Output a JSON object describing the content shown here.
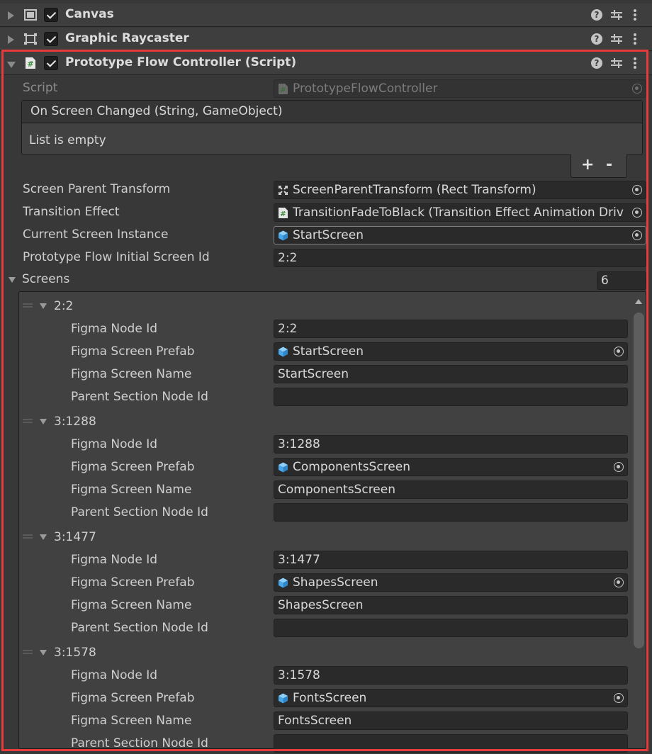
{
  "components": [
    {
      "title": "Canvas",
      "icon": "canvas-icon"
    },
    {
      "title": "Graphic Raycaster",
      "icon": "graphic-raycaster-icon"
    },
    {
      "title": "Prototype Flow Controller (Script)",
      "icon": "script-icon"
    }
  ],
  "script_field": {
    "label": "Script",
    "value": "PrototypeFlowController"
  },
  "event": {
    "title": "On Screen Changed (String, GameObject)",
    "empty_text": "List is empty",
    "add": "+",
    "remove": "-"
  },
  "props": [
    {
      "label": "Screen Parent Transform",
      "value": "ScreenParentTransform (Rect Transform)",
      "icon": "rect-transform-icon"
    },
    {
      "label": "Transition Effect",
      "value": "TransitionFadeToBlack (Transition Effect Animation Driv",
      "icon": "script-icon"
    },
    {
      "label": "Current Screen Instance",
      "value": "StartScreen",
      "icon": "prefab-cube-icon"
    },
    {
      "label": "Prototype Flow Initial Screen Id",
      "value": "2:2"
    }
  ],
  "screens": {
    "label": "Screens",
    "count": "6",
    "items": [
      {
        "id": "2:2",
        "node_id": "2:2",
        "prefab": "StartScreen",
        "name": "StartScreen",
        "parent_section": ""
      },
      {
        "id": "3:1288",
        "node_id": "3:1288",
        "prefab": "ComponentsScreen",
        "name": "ComponentsScreen",
        "parent_section": ""
      },
      {
        "id": "3:1477",
        "node_id": "3:1477",
        "prefab": "ShapesScreen",
        "name": "ShapesScreen",
        "parent_section": ""
      },
      {
        "id": "3:1578",
        "node_id": "3:1578",
        "prefab": "FontsScreen",
        "name": "FontsScreen",
        "parent_section": ""
      }
    ],
    "field_labels": {
      "node_id": "Figma Node Id",
      "prefab": "Figma Screen Prefab",
      "name": "Figma Screen Name",
      "parent_section": "Parent Section Node Id"
    }
  },
  "colors": {
    "highlight_border": "#e53b3b",
    "prefab_cube": "#4aa8e8",
    "script_green": "#5fae5f"
  }
}
